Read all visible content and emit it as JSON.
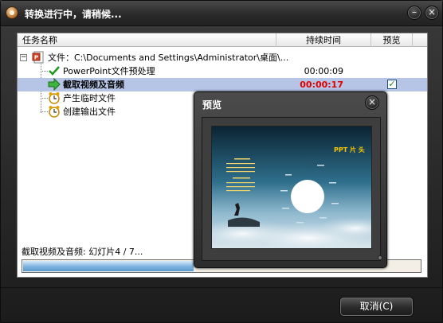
{
  "window": {
    "title": "转换进行中，请稍候...",
    "minimize_symbol": "–",
    "close_symbol": "×"
  },
  "table": {
    "columns": [
      "任务名称",
      "持续时间",
      "预览"
    ],
    "rows": [
      {
        "label": "文件：C:\\Documents and Settings\\Administrator\\桌面\\...",
        "duration": "",
        "icon": "powerpoint-file-icon",
        "expander": "−"
      },
      {
        "label": "PowerPoint文件预处理",
        "duration": "00:00:09",
        "icon": "green-check-icon"
      },
      {
        "label": "截取视频及音频",
        "duration": "00:00:17",
        "icon": "green-arrow-icon",
        "selected": true,
        "preview_checked": true
      },
      {
        "label": "产生临时文件",
        "duration": "",
        "icon": "alarm-clock-icon"
      },
      {
        "label": "创建输出文件",
        "duration": "",
        "icon": "alarm-clock-icon"
      }
    ],
    "preview_check_symbol": "✓"
  },
  "status": {
    "text": "截取视频及音频: 幻灯片4 / 7...",
    "progress": 0.43
  },
  "buttons": {
    "cancel": "取消(C)"
  },
  "preview": {
    "title": "预览",
    "close_symbol": "×",
    "slide_title": "PPT 片 头"
  },
  "colors": {
    "selected_row": "#b6c4e6",
    "duration_active": "#e00000",
    "progress_fill": "#7cb3e0",
    "window_chrome": "#2b2b2b"
  }
}
